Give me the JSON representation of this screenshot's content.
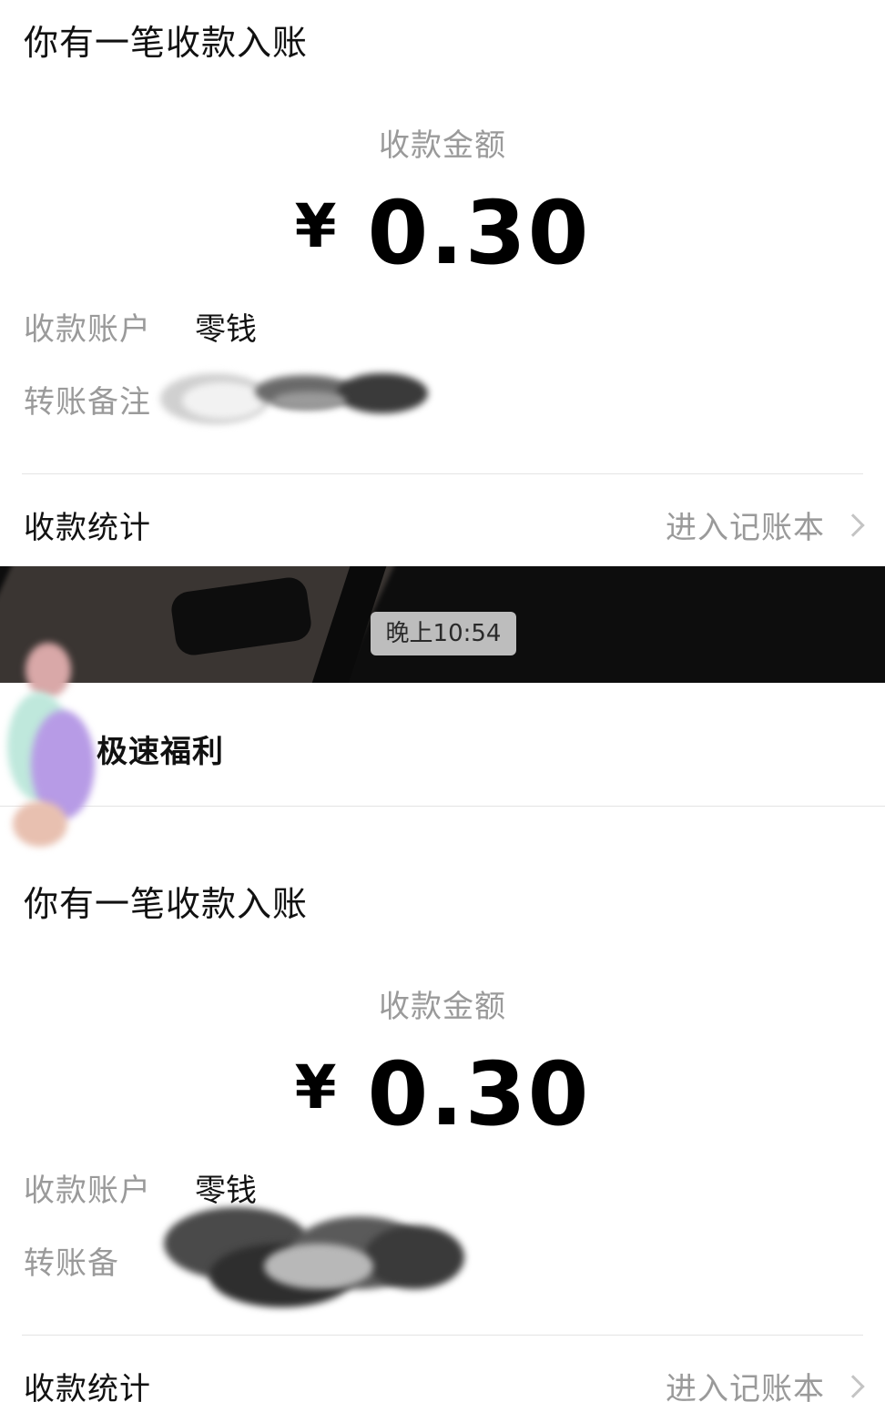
{
  "notices": [
    {
      "title": "你有一笔收款入账",
      "amount_label": "收款金额",
      "currency_symbol": "¥",
      "amount": "0.30",
      "account_label": "收款账户",
      "account_value": "零钱",
      "note_label": "转账备注",
      "stats_label": "收款统计",
      "ledger_link": "进入记账本"
    },
    {
      "title": "你有一笔收款入账",
      "amount_label": "收款金额",
      "currency_symbol": "¥",
      "amount": "0.30",
      "account_label": "收款账户",
      "account_value": "零钱",
      "note_label": "转账备",
      "stats_label": "收款统计",
      "ledger_link": "进入记账本"
    }
  ],
  "chat": {
    "timestamp": "晚上10:54",
    "sender_name": "极速福利"
  },
  "icons": {
    "chevron": "chevron-right-icon"
  }
}
